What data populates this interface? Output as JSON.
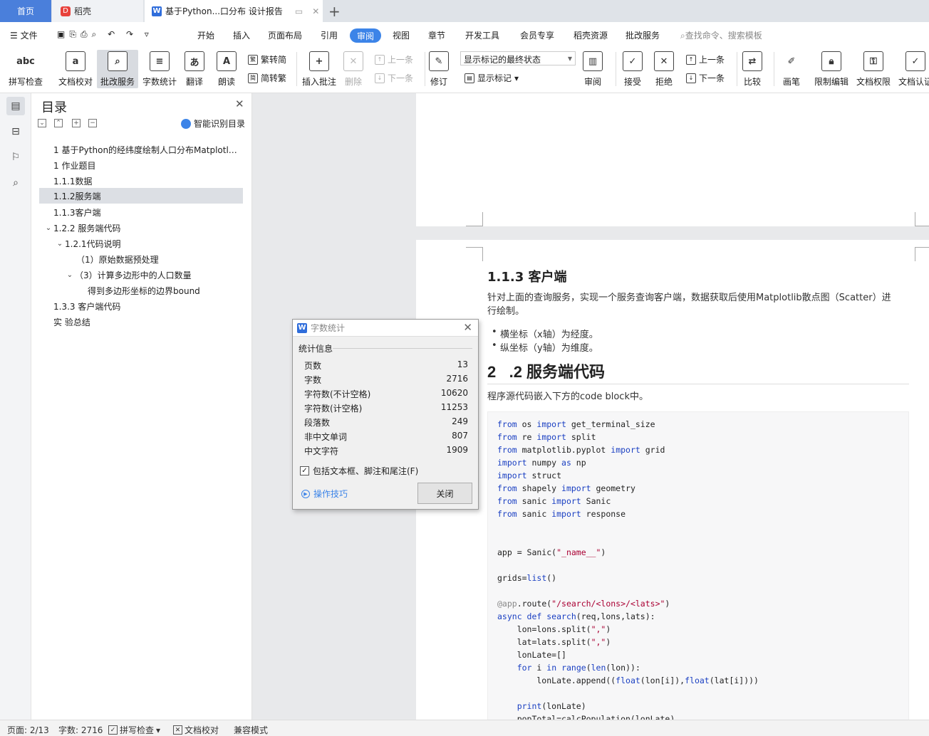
{
  "tabs": {
    "home": "首页",
    "daoke": "稻壳",
    "doc": "基于Python...口分布 设计报告"
  },
  "menu": {
    "file": "文件",
    "items": [
      "开始",
      "插入",
      "页面布局",
      "引用",
      "审阅",
      "视图",
      "章节",
      "开发工具",
      "会员专享",
      "稻壳资源",
      "批改服务"
    ],
    "active": "审阅",
    "search": "查找命令、搜索模板"
  },
  "ribbon": {
    "spell": "拼写检查",
    "proof": "文档校对",
    "grading": "批改服务",
    "wordcount": "字数统计",
    "translate": "翻译",
    "read": "朗读",
    "trad": "繁转简",
    "simp": "简转繁",
    "add_comment": "插入批注",
    "delete": "删除",
    "prev": "上一条",
    "next": "下一条",
    "revise": "修订",
    "markup_state": "显示标记的最终状态",
    "show_markup": "显示标记",
    "review": "审阅",
    "accept": "接受",
    "reject": "拒绝",
    "prev2": "上一条",
    "next2": "下一条",
    "compare": "比较",
    "pen": "画笔",
    "restrict": "限制编辑",
    "perm": "文档权限",
    "cert": "文档认证"
  },
  "toc": {
    "title": "目录",
    "smart": "智能识别目录",
    "items": [
      "1 基于Python的经纬度绘制人口分布Matplotl…",
      "1 作业题目",
      "1.1.1数据",
      "1.1.2服务端",
      "1.1.3客户端",
      "1.2.2 服务端代码",
      "1.2.1代码说明",
      "（1）原始数据预处理",
      "（3）计算多边形中的人口数量",
      "得到多边形坐标的边界bound",
      "1.3.3 客户端代码",
      "实 验总结"
    ]
  },
  "doc": {
    "h113": "1.1.3  客户端",
    "para1": "针对上面的查询服务，实现一个服务查询客户端，数据获取后使用Matplotlib散点图（Scatter）进行绘制。",
    "bullet1": "横坐标（x轴）为经度。",
    "bullet2": "纵坐标（y轴）为维度。",
    "h2_num": "2",
    "h2_text": ".2 服务端代码",
    "para2": "程序源代码嵌入下方的code block中。"
  },
  "dialog": {
    "title": "字数统计",
    "group": "统计信息",
    "stats": [
      {
        "k": "页数",
        "v": "13"
      },
      {
        "k": "字数",
        "v": "2716"
      },
      {
        "k": "字符数(不计空格)",
        "v": "10620"
      },
      {
        "k": "字符数(计空格)",
        "v": "11253"
      },
      {
        "k": "段落数",
        "v": "249"
      },
      {
        "k": "非中文单词",
        "v": "807"
      },
      {
        "k": "中文字符",
        "v": "1909"
      }
    ],
    "check": "包括文本框、脚注和尾注(F)",
    "tips": "操作技巧",
    "close": "关闭"
  },
  "status": {
    "page": "页面: 2/13",
    "words": "字数: 2716",
    "spell": "拼写检查",
    "proof": "文档校对",
    "compat": "兼容模式"
  }
}
